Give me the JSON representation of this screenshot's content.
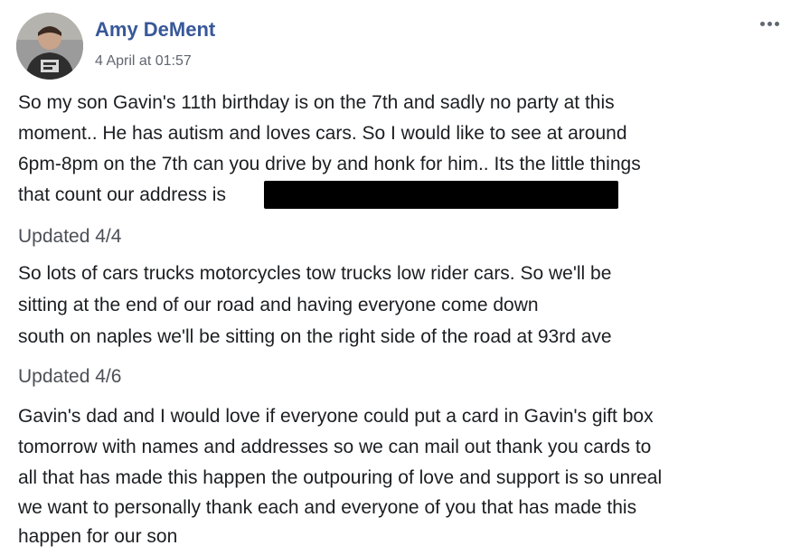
{
  "post": {
    "author": "Amy DeMent",
    "timestamp": "4 April at 01:57",
    "avatar_icon": "user-avatar",
    "more_icon": "more-options-icon",
    "paragraph1": [
      "So my son Gavin's 11th birthday is on the 7th and sadly no party at this",
      "moment.. He has autism and loves cars. So I would like to see at around",
      "6pm-8pm on the 7th can you drive by and honk for him.. Its the little things",
      "that count our address is"
    ],
    "update1_label": "Updated 4/4",
    "paragraph2": [
      "So lots of cars trucks motorcycles tow trucks low rider cars. So we'll be",
      "sitting at the end of our road and having everyone come down",
      "south on naples we'll be sitting on the right side of the road at 93rd ave"
    ],
    "update2_label": "Updated 4/6",
    "paragraph3": [
      "Gavin's dad and I would love if everyone could put a card in Gavin's gift box",
      "tomorrow with names and addresses so we can mail out thank you cards to",
      "all that has made this happen the outpouring of love and support is so unreal",
      "we want to personally thank each and everyone of you that has made this",
      "happen for our son"
    ]
  },
  "colors": {
    "author_link": "#385898",
    "text": "#1c1e21",
    "meta": "#616770",
    "redaction": "#000000"
  }
}
